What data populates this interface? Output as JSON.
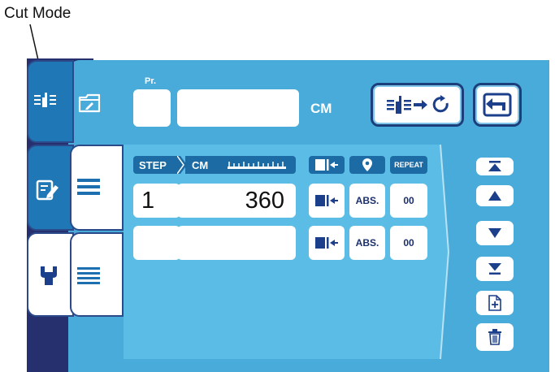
{
  "annotation": {
    "cut_mode_label": "Cut Mode"
  },
  "top": {
    "pr_label": "Pr.",
    "program_number": "",
    "program_name": "",
    "unit_label": "CM"
  },
  "table": {
    "headers": {
      "step": "STEP",
      "cm": "CM",
      "repeat": "REPEAT"
    },
    "rows": [
      {
        "step": "1",
        "value": "360",
        "mode": "ABS.",
        "repeat": "00"
      },
      {
        "step": "",
        "value": "",
        "mode": "ABS.",
        "repeat": "00"
      }
    ]
  },
  "icons": {
    "cut_mode_tab": "cut-mode-icon",
    "edit_tab": "edit-note-icon",
    "settings_tab": "wrench-icon",
    "folder": "folder-edit-icon",
    "cut_cycle": "cut-cycle-icon",
    "back": "back-icon",
    "list_tab_1": "list-icon",
    "list_tab_2": "list-dense-icon",
    "scroll": [
      "first-icon",
      "up-icon",
      "down-icon",
      "last-icon",
      "add-step-icon",
      "delete-icon"
    ]
  },
  "colors": {
    "panel_blue": "#49abd9",
    "dark_navy": "#27306e",
    "header_blue": "#1d6ba4",
    "tab_blue": "#1f78b5"
  }
}
